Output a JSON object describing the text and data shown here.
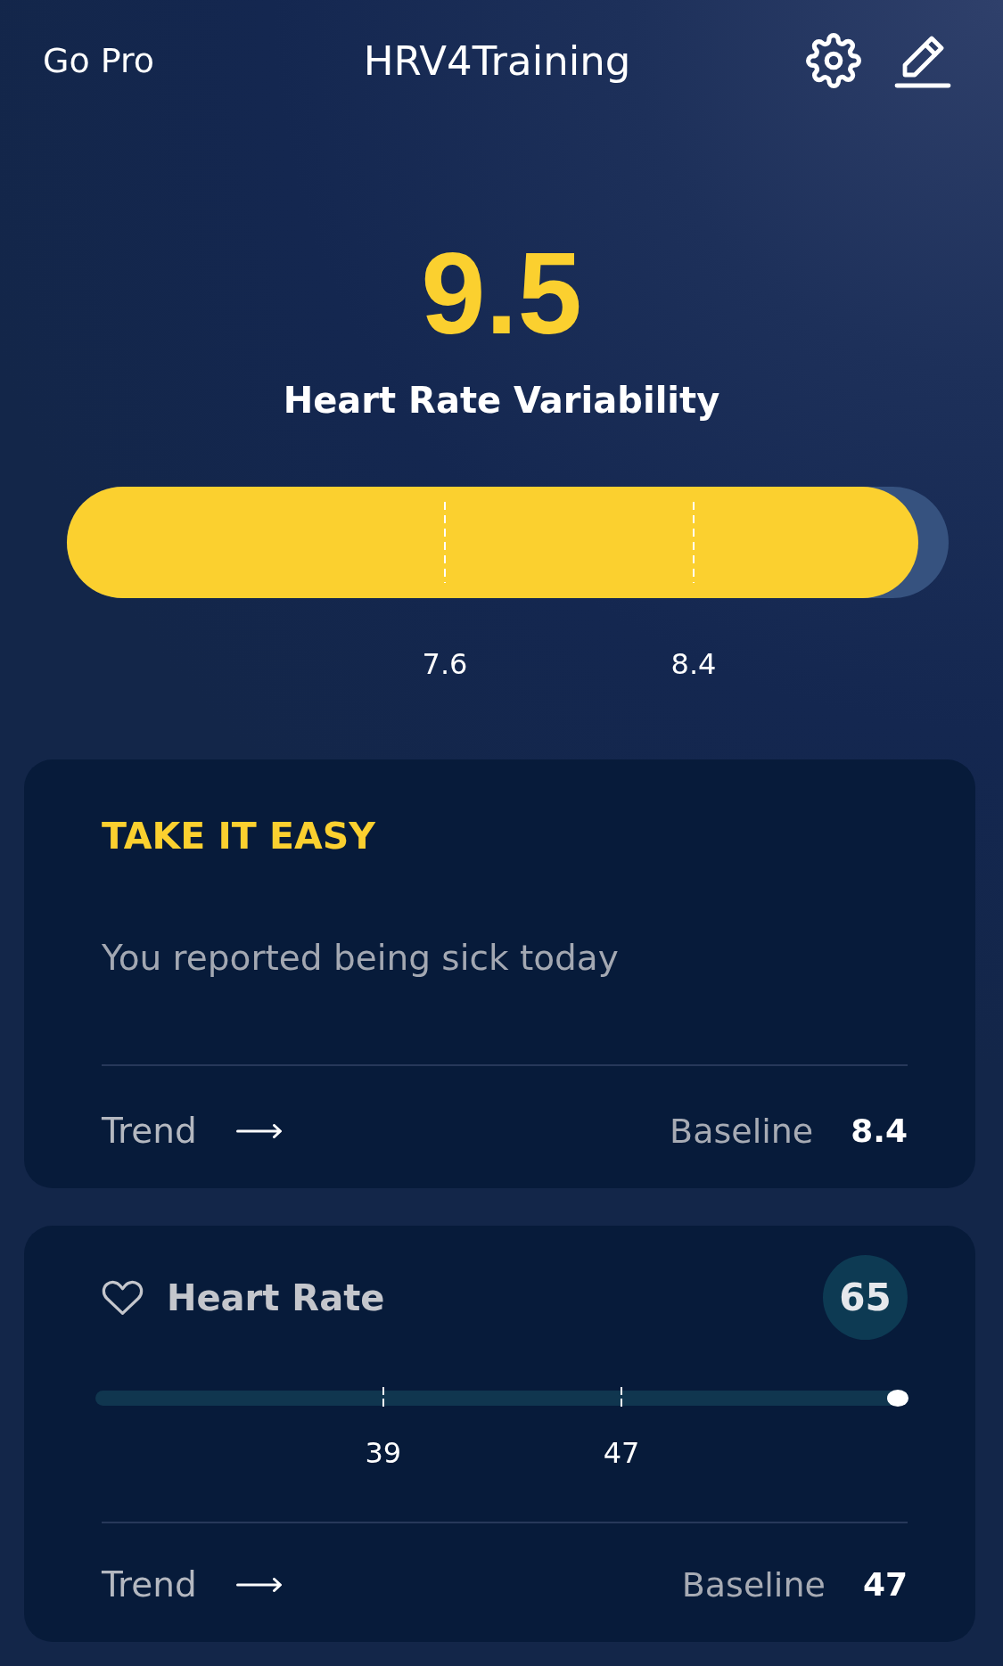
{
  "header": {
    "go_pro": "Go Pro",
    "title": "HRV4Training"
  },
  "hrv": {
    "value": "9.5",
    "label": "Heart Rate Variability",
    "level": 0.966,
    "markers": [
      "7.6",
      "8.4"
    ]
  },
  "advice_card": {
    "title": "TAKE IT EASY",
    "message": "You reported being sick today",
    "trend_label": "Trend",
    "baseline_label": "Baseline",
    "baseline_value": "8.4"
  },
  "heart_rate_card": {
    "title": "Heart Rate",
    "value": "65",
    "level": 1,
    "markers": [
      "39",
      "47"
    ],
    "trend_label": "Trend",
    "baseline_label": "Baseline",
    "baseline_value": "47"
  }
}
